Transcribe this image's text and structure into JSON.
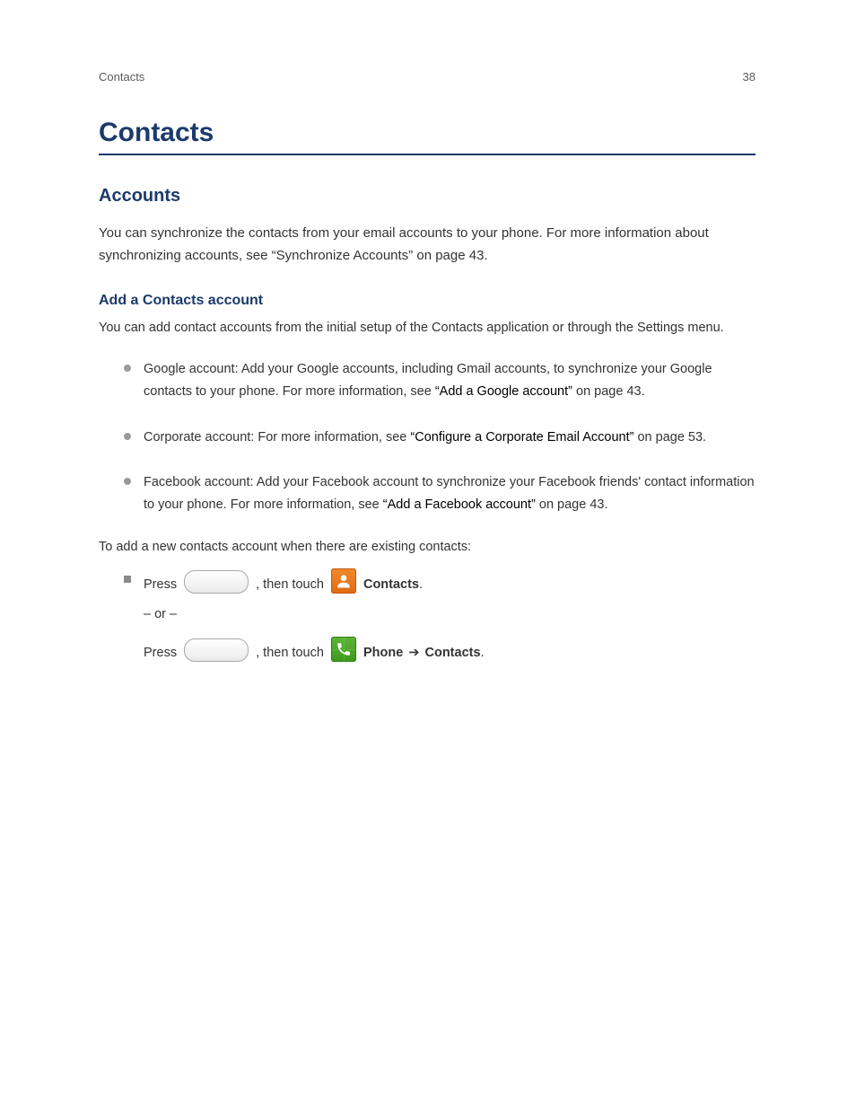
{
  "header": {
    "left": "Contacts",
    "right": "38"
  },
  "title": "Contacts",
  "section": "Accounts",
  "lead": "You can synchronize the contacts from your email accounts to your phone. For more information about synchronizing accounts, see “Synchronize Accounts” on page 43.",
  "add_account": {
    "heading": "Add a Contacts account",
    "intro": "You can add contact accounts from the initial setup of the Contacts application or through the Settings menu.",
    "bullets": [
      {
        "text": "Google account: Add your Google accounts, including Gmail accounts, to synchronize your Google contacts to your phone. For more information, see ",
        "link": "“Add a Google account”",
        "page": " on page 43."
      },
      {
        "text": "Corporate account: For more information, see ",
        "link": "“Configure a Corporate Email Account”",
        "page": " on page 53."
      },
      {
        "text": "Facebook account: Add your Facebook account to synchronize your Facebook friends' contact information to your phone. For more information, see ",
        "link": "“Add a Facebook account”",
        "page": " on page 43."
      }
    ]
  },
  "proc": {
    "header": "To add a new contacts account when there are existing contacts:",
    "step_prefix": "Press ",
    "then_touch": ", then touch ",
    "contacts_label": "Contacts",
    "or": "– or –",
    "phone_label": "Phone",
    "arrow": " ➔ ",
    "contacts_tab": "Contacts"
  }
}
